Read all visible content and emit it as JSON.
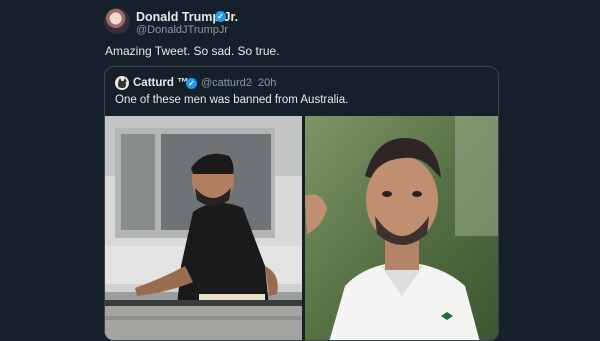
{
  "author": {
    "name": "Donald Trump Jr.",
    "handle": "@DonaldJTrumpJr",
    "verified_icon": "verified-badge-icon"
  },
  "tweet": {
    "text": "Amazing Tweet. So sad. So true."
  },
  "quote": {
    "name": "Catturd ™",
    "handle": "@catturd2",
    "separator": "·",
    "time": "20h",
    "text": "One of these men was banned from Australia.",
    "verified_icon": "verified-badge-icon",
    "media": [
      {
        "name": "photo-man-on-balcony"
      },
      {
        "name": "photo-tennis-player"
      }
    ]
  },
  "colors": {
    "background": "#15202b",
    "text": "#e7e9ea",
    "secondary_text": "#8b98a5",
    "border": "#38444d",
    "verified": "#1d9bf0"
  }
}
